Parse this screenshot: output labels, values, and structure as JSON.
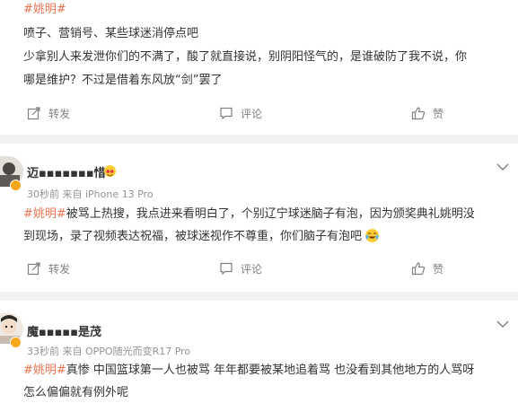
{
  "post1": {
    "hashtag": "#姚明#",
    "line1": "喷子、营销号、某些球迷消停点吧",
    "line2": "少拿别人来发泄你们的不满了，酸了就直接说，别阴阳怪气的，是谁破防了我不说，你",
    "line3": "哪是维护？不过是借着东风放“剑”罢了",
    "actions": {
      "repost": "转发",
      "comment": "评论",
      "like": "赞"
    }
  },
  "post2": {
    "username": "迈▪▪▪▪▪▪▪惜",
    "meta": "30秒前 来自 iPhone 13 Pro",
    "hashtag": "#姚明#",
    "line1": "被骂上热搜，我点进来看明白了，个别辽宁球迷脑子有泡，因为颁奖典礼姚明没",
    "line2": "到现场，录了视频表达祝福，被球迷视作不尊重，你们脑子有泡吧",
    "actions": {
      "repost": "转发",
      "comment": "评论",
      "like": "赞"
    }
  },
  "post3": {
    "username": "魔▪▪▪▪▪是茂",
    "meta": "33秒前 来自 OPPO随光而变R17 Pro",
    "hashtag": "#姚明#",
    "line1": "真惨 中国篮球第一人也被骂 年年都要被某地追着骂 也没看到其他地方的人骂呀",
    "line2": "怎么偏偏就有例外呢"
  },
  "colors": {
    "hashtag": "#eb7350",
    "meta": "#939393",
    "divider": "#f2f2f2",
    "badge": "#f7a81b"
  }
}
